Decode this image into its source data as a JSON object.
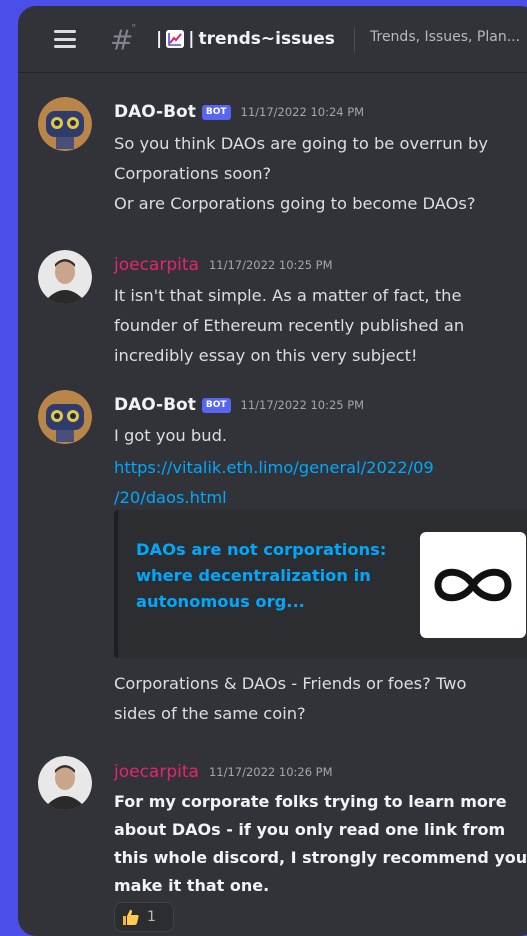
{
  "channel": {
    "name": "trends~issues",
    "separator": "|",
    "emoji_icon": "chart-increasing-emoji",
    "topic": "Trends, Issues, Plan..."
  },
  "messages": [
    {
      "author": "DAO-Bot",
      "badge": "BOT",
      "timestamp": "11/17/2022 10:24 PM",
      "lines": [
        "So you think DAOs are going to be overrun by",
        "Corporations soon?",
        "Or are Corporations going to become DAOs?"
      ]
    },
    {
      "author": "joecarpita",
      "timestamp": "11/17/2022 10:25 PM",
      "lines": [
        "It isn't that simple. As a matter of fact, the",
        "founder of Ethereum recently published an",
        "incredibly essay on this very subject!"
      ]
    },
    {
      "author": "DAO-Bot",
      "badge": "BOT",
      "timestamp": "11/17/2022 10:25 PM",
      "lines": [
        "I got you bud."
      ],
      "link_lines": [
        "https://vitalik.eth.limo/general/2022/09",
        "/20/daos.html"
      ],
      "embed": {
        "title_lines": [
          "DAOs are not corporations:",
          "where decentralization in",
          "autonomous org..."
        ],
        "thumbnail_icon": "infinity-icon"
      },
      "after_lines": [
        "Corporations & DAOs - Friends or foes? Two",
        "sides of the same coin?"
      ]
    },
    {
      "author": "joecarpita",
      "timestamp": "11/17/2022 10:26 PM",
      "lines": [
        "For my corporate folks trying to learn more",
        "about DAOs - if you only read one link from",
        "this whole discord, I strongly recommend you",
        "make it that one."
      ],
      "reaction": {
        "icon": "thumbs-up-icon",
        "count": "1"
      }
    }
  ],
  "colors": {
    "background": "#4b4ee9",
    "panel": "#313338",
    "link": "#00a8fc",
    "user_pink": "#e6246f",
    "bot_badge": "#5865f2"
  }
}
